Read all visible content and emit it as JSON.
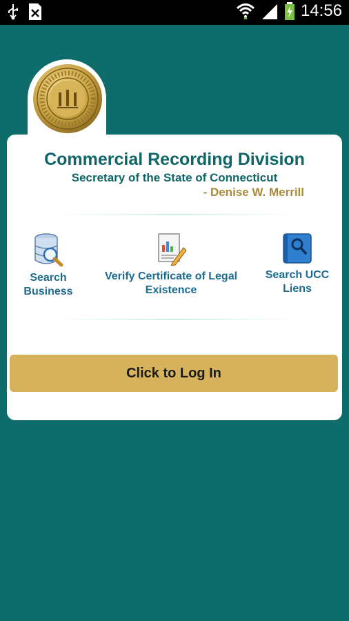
{
  "status_bar": {
    "time": "14:56",
    "icons": [
      "usb-icon",
      "sim-icon",
      "wifi-icon",
      "signal-icon",
      "battery-icon"
    ]
  },
  "header": {
    "title": "Commercial Recording Division",
    "subtitle": "Secretary of the State of Connecticut",
    "author": "- Denise W. Merrill"
  },
  "actions": [
    {
      "line1": "Search",
      "line2": "Business",
      "icon": "database-search-icon"
    },
    {
      "line1": "Verify Certificate of Legal",
      "line2": "Existence",
      "icon": "certificate-icon"
    },
    {
      "line1": "Search UCC",
      "line2": "Liens",
      "icon": "book-search-icon"
    }
  ],
  "login_button": {
    "label": "Click to Log In"
  },
  "colors": {
    "background": "#0e6d6b",
    "title": "#0f6567",
    "action_label": "#1b6b8e",
    "author": "#a88a3a",
    "button": "#d6b25d"
  }
}
